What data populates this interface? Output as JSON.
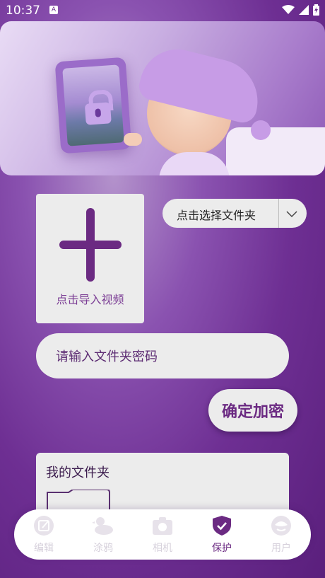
{
  "status_bar": {
    "time": "10:37",
    "badge": "A"
  },
  "hero": {
    "icon": "lock-icon"
  },
  "import_card": {
    "label": "点击导入视频",
    "icon": "plus-icon"
  },
  "folder_select": {
    "label": "点击选择文件夹",
    "icon": "chevron-down-icon"
  },
  "password_field": {
    "placeholder": "请输入文件夹密码",
    "value": ""
  },
  "confirm_button": {
    "label": "确定加密"
  },
  "my_folders": {
    "title": "我的文件夹",
    "icon": "folder-icon"
  },
  "nav": {
    "items": [
      {
        "label": "编辑",
        "icon": "edit-icon",
        "active": false
      },
      {
        "label": "涂鸦",
        "icon": "duck-icon",
        "active": false
      },
      {
        "label": "相机",
        "icon": "camera-icon",
        "active": false
      },
      {
        "label": "保护",
        "icon": "shield-check-icon",
        "active": true
      },
      {
        "label": "用户",
        "icon": "user-icon",
        "active": false
      }
    ]
  },
  "colors": {
    "accent": "#6b2a82",
    "card": "#ececec",
    "inactive": "#d6d0db"
  }
}
